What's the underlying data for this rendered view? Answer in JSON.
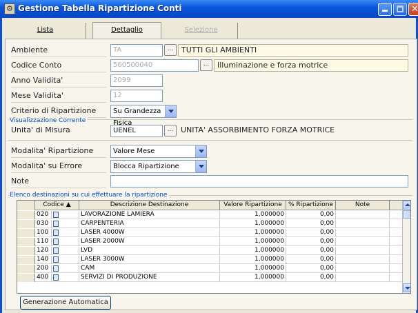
{
  "window": {
    "title": "Gestione Tabella Ripartizione Conti"
  },
  "tabs": [
    {
      "label": "Lista"
    },
    {
      "label": "Dettaglio"
    },
    {
      "label": "Selezione"
    }
  ],
  "form": {
    "ambiente": {
      "label": "Ambiente",
      "code": "TA",
      "description": "TUTTI GLI AMBIENTI"
    },
    "codice_conto": {
      "label": "Codice Conto",
      "code": "560500040",
      "description": "Illuminazione e forza motrice"
    },
    "anno_validita": {
      "label": "Anno Validita'",
      "value": "2099"
    },
    "mese_validita": {
      "label": "Mese Validita'",
      "value": "12"
    },
    "criterio": {
      "label": "Criterio di Ripartizione",
      "value": "Su Grandezza Fisica"
    },
    "visualizzazione_title": "Visualizzazione Corrente",
    "unita_misura": {
      "label": "Unita' di Misura",
      "code": "UENEL",
      "description": "UNITA' ASSORBIMENTO FORZA MOTRICE"
    },
    "modalita_ripartizione": {
      "label": "Modalita' Ripartizione",
      "value": "Valore Mese"
    },
    "modalita_errore": {
      "label": "Modalita' su Errore",
      "value": "Blocca Ripartizione"
    },
    "note": {
      "label": "Note",
      "value": ""
    }
  },
  "grid": {
    "title": "Elenco destinazioni su cui effettuare la ripartizione",
    "headers": [
      "Codice",
      "Descrizione Destinazione",
      "Valore Ripartizione",
      "% Ripartizione",
      "Note"
    ],
    "rows": [
      {
        "codice": "020",
        "descrizione": "LAVORAZIONE LAMIERA",
        "valore": "1,000000",
        "perc": "0,00",
        "note": ""
      },
      {
        "codice": "030",
        "descrizione": "CARPENTERIA",
        "valore": "1,000000",
        "perc": "0,00",
        "note": ""
      },
      {
        "codice": "100",
        "descrizione": "LASER 4000W",
        "valore": "1,000000",
        "perc": "0,00",
        "note": ""
      },
      {
        "codice": "110",
        "descrizione": "LASER 2000W",
        "valore": "1,000000",
        "perc": "0,00",
        "note": ""
      },
      {
        "codice": "120",
        "descrizione": "LVD",
        "valore": "1,000000",
        "perc": "0,00",
        "note": ""
      },
      {
        "codice": "140",
        "descrizione": "LASER 3000W",
        "valore": "1,000000",
        "perc": "0,00",
        "note": ""
      },
      {
        "codice": "200",
        "descrizione": "CAM",
        "valore": "1,000000",
        "perc": "0,00",
        "note": ""
      },
      {
        "codice": "400",
        "descrizione": "SERVIZI DI PRODUZIONE",
        "valore": "1,000000",
        "perc": "0,00",
        "note": ""
      }
    ]
  },
  "buttons": {
    "generazione": "Generazione Automatica",
    "ellipsis": "..."
  }
}
